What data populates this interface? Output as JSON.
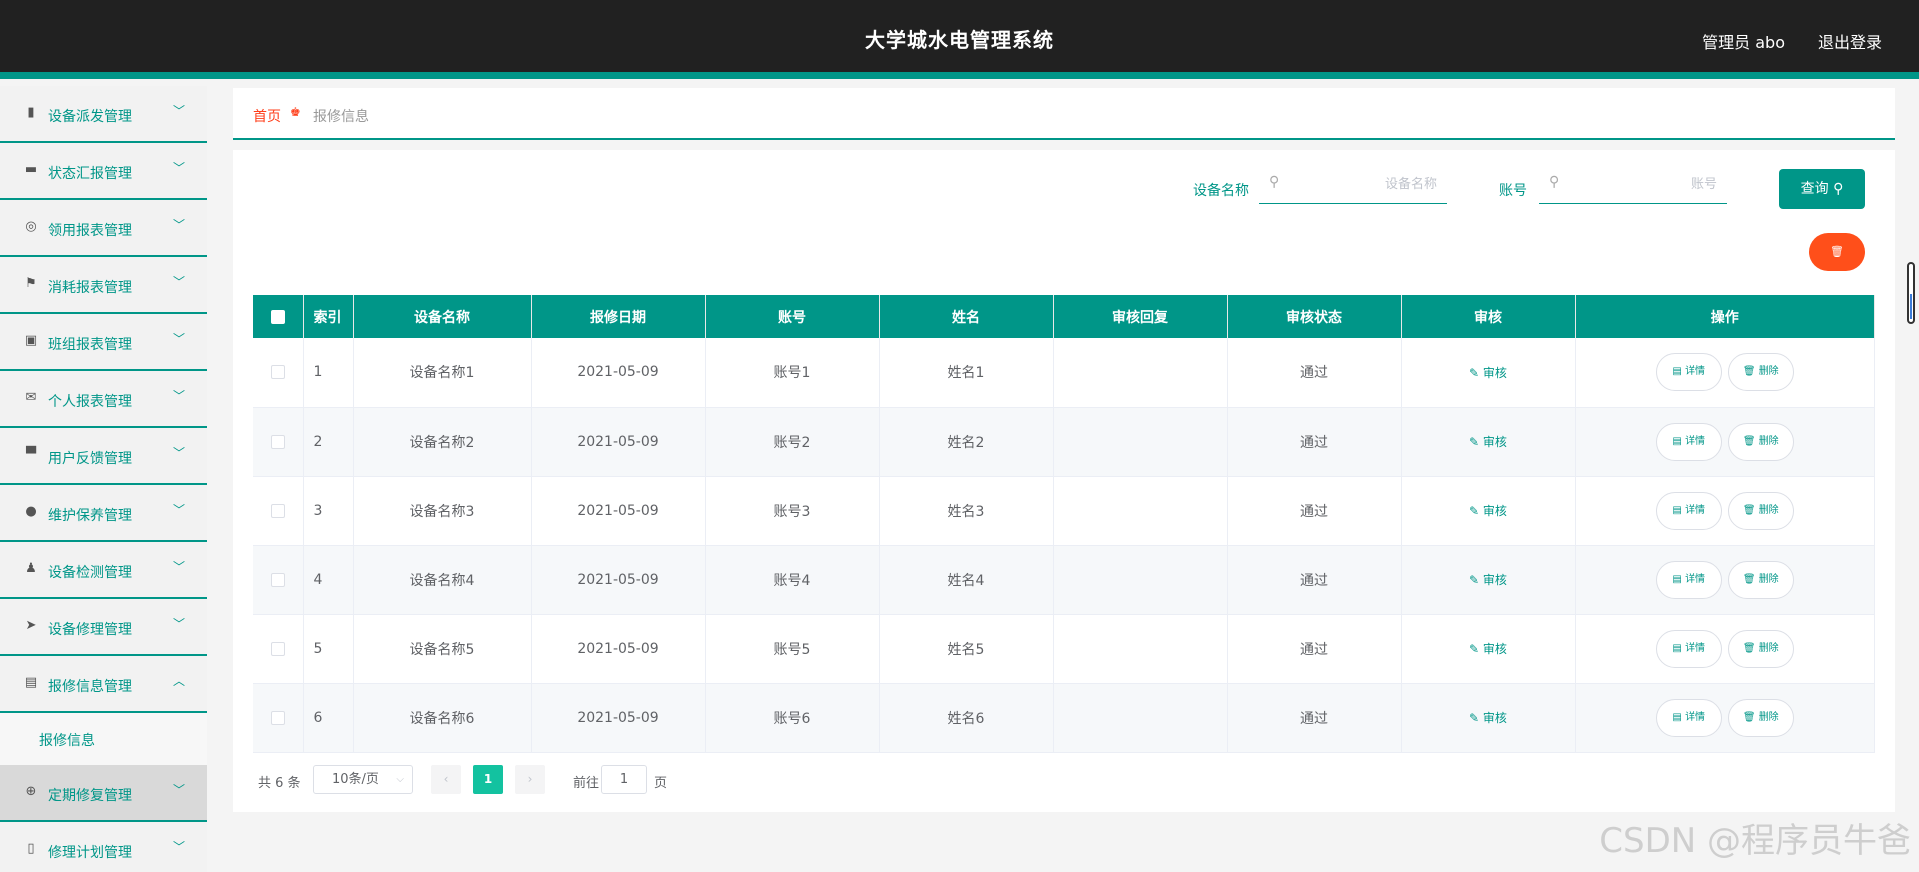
{
  "header": {
    "title": "大学城水电管理系统",
    "user": "管理员 abo",
    "logout": "退出登录"
  },
  "sidebar": {
    "items": [
      {
        "label": "设备派发管理",
        "icon": "bar-chart-icon",
        "glyph": "▮",
        "expanded": false
      },
      {
        "label": "状态汇报管理",
        "icon": "monitor-icon",
        "glyph": "▬",
        "expanded": false
      },
      {
        "label": "领用报表管理",
        "icon": "lifebuoy-icon",
        "glyph": "◎",
        "expanded": false
      },
      {
        "label": "消耗报表管理",
        "icon": "flag-icon",
        "glyph": "⚑",
        "expanded": false
      },
      {
        "label": "班组报表管理",
        "icon": "clipboard-check-icon",
        "glyph": "▣",
        "expanded": false
      },
      {
        "label": "个人报表管理",
        "icon": "envelope-icon",
        "glyph": "✉",
        "expanded": false
      },
      {
        "label": "用户反馈管理",
        "icon": "podium-icon",
        "glyph": "▀",
        "expanded": false
      },
      {
        "label": "维护保养管理",
        "icon": "shield-icon",
        "glyph": "●",
        "expanded": false
      },
      {
        "label": "设备检测管理",
        "icon": "user-icon",
        "glyph": "♟",
        "expanded": false
      },
      {
        "label": "设备修理管理",
        "icon": "paper-plane-icon",
        "glyph": "➤",
        "expanded": false
      },
      {
        "label": "报修信息管理",
        "icon": "clipboard-x-icon",
        "glyph": "▤",
        "expanded": true
      },
      {
        "label": "定期修复管理",
        "icon": "crosshair-icon",
        "glyph": "⊕",
        "expanded": false
      },
      {
        "label": "修理计划管理",
        "icon": "phone-icon",
        "glyph": "▯",
        "expanded": false
      }
    ],
    "submenu_label": "报修信息"
  },
  "breadcrumb": {
    "home": "首页",
    "current": "报修信息"
  },
  "search": {
    "device_label": "设备名称",
    "device_placeholder": "设备名称",
    "account_label": "账号",
    "account_placeholder": "账号",
    "query_button": "查询"
  },
  "table": {
    "headers": [
      "索引",
      "设备名称",
      "报修日期",
      "账号",
      "姓名",
      "审核回复",
      "审核状态",
      "审核",
      "操作"
    ],
    "rows": [
      {
        "index": "1",
        "device": "设备名称1",
        "date": "2021-05-09",
        "account": "账号1",
        "name": "姓名1",
        "reply": "",
        "status": "通过"
      },
      {
        "index": "2",
        "device": "设备名称2",
        "date": "2021-05-09",
        "account": "账号2",
        "name": "姓名2",
        "reply": "",
        "status": "通过"
      },
      {
        "index": "3",
        "device": "设备名称3",
        "date": "2021-05-09",
        "account": "账号3",
        "name": "姓名3",
        "reply": "",
        "status": "通过"
      },
      {
        "index": "4",
        "device": "设备名称4",
        "date": "2021-05-09",
        "account": "账号4",
        "name": "姓名4",
        "reply": "",
        "status": "通过"
      },
      {
        "index": "5",
        "device": "设备名称5",
        "date": "2021-05-09",
        "account": "账号5",
        "name": "姓名5",
        "reply": "",
        "status": "通过"
      },
      {
        "index": "6",
        "device": "设备名称6",
        "date": "2021-05-09",
        "account": "账号6",
        "name": "姓名6",
        "reply": "",
        "status": "通过"
      }
    ],
    "audit_label": "审核",
    "detail_label": "详情",
    "delete_label": "删除"
  },
  "pagination": {
    "total": "共 6 条",
    "page_size": "10条/页",
    "current_page": "1",
    "goto_prefix": "前往",
    "goto_value": "1",
    "goto_suffix": "页"
  },
  "watermark": "CSDN @程序员牛爸",
  "colors": {
    "accent": "#009688",
    "danger": "#ff4f1a",
    "header_bg": "#212121",
    "breadcrumb_home": "#ff3e1a"
  }
}
